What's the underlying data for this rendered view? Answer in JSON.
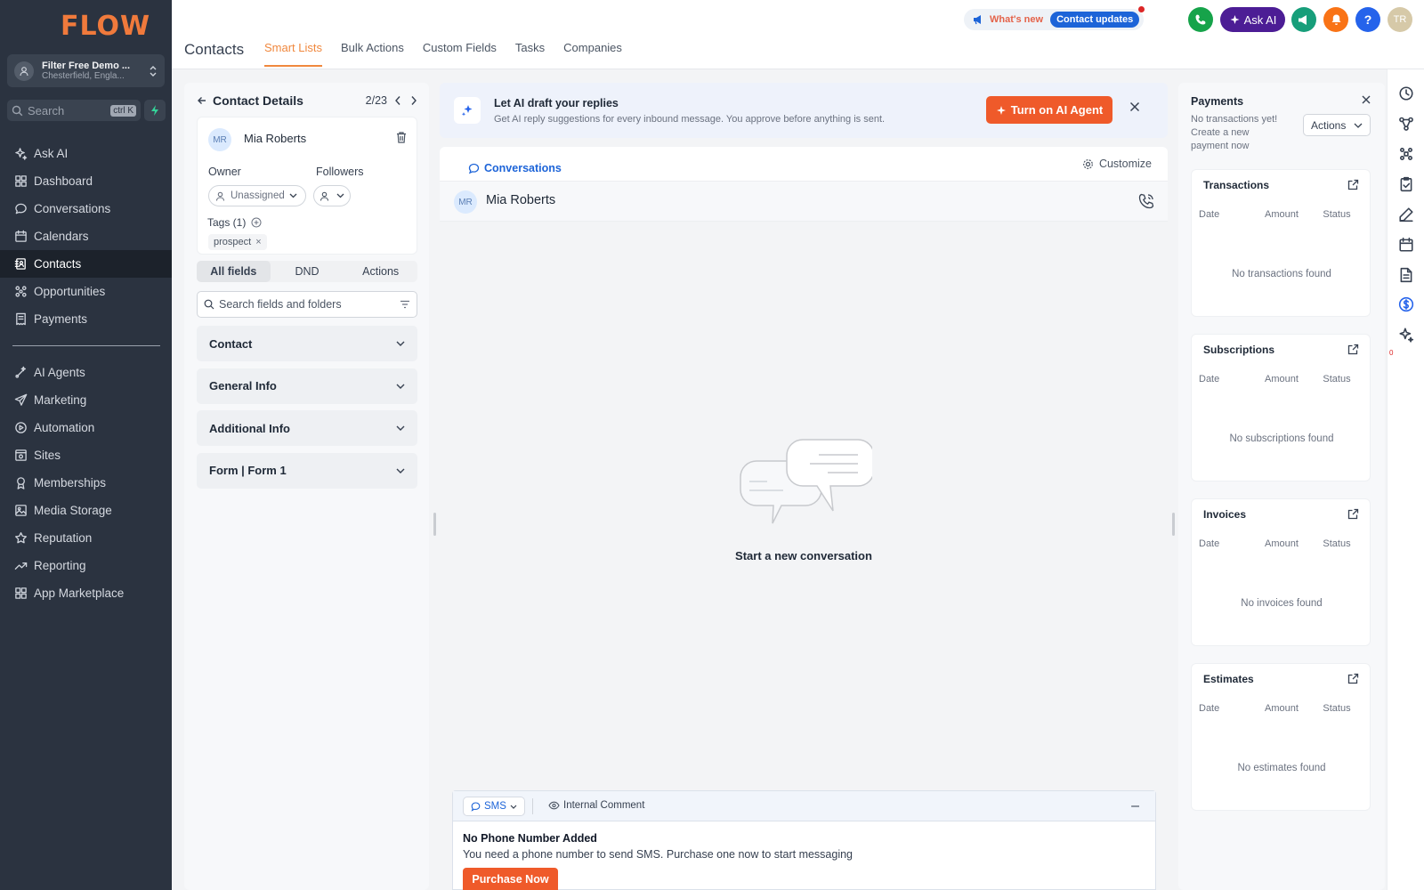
{
  "brand": {
    "logo_text": "FLOW",
    "accent": "#f0883e",
    "primary": "#1d64d8",
    "cta": "#ef5a2a"
  },
  "location": {
    "name": "Filter Free Demo ...",
    "sub": "Chesterfield, Engla..."
  },
  "sidebar": {
    "search_placeholder": "Search",
    "search_shortcut": "ctrl K",
    "items": [
      {
        "label": "Ask AI",
        "icon": "sparkle-icon"
      },
      {
        "label": "Dashboard",
        "icon": "dashboard-icon"
      },
      {
        "label": "Conversations",
        "icon": "chat-icon"
      },
      {
        "label": "Calendars",
        "icon": "calendar-icon"
      },
      {
        "label": "Contacts",
        "icon": "contacts-icon",
        "active": true
      },
      {
        "label": "Opportunities",
        "icon": "opportunities-icon"
      },
      {
        "label": "Payments",
        "icon": "payments-icon"
      }
    ],
    "items2": [
      {
        "label": "AI Agents",
        "icon": "ai-agents-icon"
      },
      {
        "label": "Marketing",
        "icon": "send-icon"
      },
      {
        "label": "Automation",
        "icon": "automation-icon"
      },
      {
        "label": "Sites",
        "icon": "sites-icon"
      },
      {
        "label": "Memberships",
        "icon": "membership-icon"
      },
      {
        "label": "Media Storage",
        "icon": "image-icon"
      },
      {
        "label": "Reputation",
        "icon": "star-icon"
      },
      {
        "label": "Reporting",
        "icon": "trend-icon"
      },
      {
        "label": "App Marketplace",
        "icon": "grid-icon"
      }
    ]
  },
  "header": {
    "title": "Contacts",
    "tabs": [
      "Smart Lists",
      "Bulk Actions",
      "Custom Fields",
      "Tasks",
      "Companies"
    ],
    "active_tab": "Smart Lists",
    "whats_new": "What's new",
    "contact_updates": "Contact updates",
    "ask_ai": "Ask AI",
    "user_initials": "TR"
  },
  "contact_details": {
    "title": "Contact Details",
    "count": "2/23",
    "avatar_initials": "MR",
    "name": "Mia Roberts",
    "owner_label": "Owner",
    "owner_value": "Unassigned",
    "followers_label": "Followers",
    "tags_label": "Tags (1)",
    "tags": [
      "prospect"
    ],
    "segments": [
      "All fields",
      "DND",
      "Actions"
    ],
    "field_search_placeholder": "Search fields and folders",
    "sections": [
      "Contact",
      "General Info",
      "Additional Info",
      "Form | Form 1"
    ]
  },
  "ai_banner": {
    "title": "Let AI draft your replies",
    "subtitle": "Get AI reply suggestions for every inbound message. You approve before anything is sent.",
    "button": "Turn on AI Agent"
  },
  "conversation": {
    "tab": "Conversations",
    "customize": "Customize",
    "avatar_initials": "MR",
    "contact_name": "Mia Roberts",
    "empty_text": "Start a new conversation",
    "channel": "SMS",
    "internal_comment": "Internal Comment",
    "no_phone_title": "No Phone Number Added",
    "no_phone_sub": "You need a phone number to send SMS. Purchase one now to start messaging",
    "purchase_button": "Purchase Now"
  },
  "payments": {
    "title": "Payments",
    "subtitle": "No transactions yet! Create a new payment now",
    "actions": "Actions",
    "columns": [
      "Date",
      "Amount",
      "Status"
    ],
    "cards": [
      {
        "title": "Transactions",
        "empty": "No transactions found"
      },
      {
        "title": "Subscriptions",
        "empty": "No subscriptions found"
      },
      {
        "title": "Invoices",
        "empty": "No invoices found"
      },
      {
        "title": "Estimates",
        "empty": "No estimates found"
      }
    ]
  },
  "rail": {
    "icons": [
      "history-icon",
      "workflow-icon",
      "apps-icon",
      "task-icon",
      "edit-icon",
      "calendar-icon",
      "document-icon",
      "dollar-icon",
      "sparkle-icon"
    ],
    "badge": "0"
  }
}
